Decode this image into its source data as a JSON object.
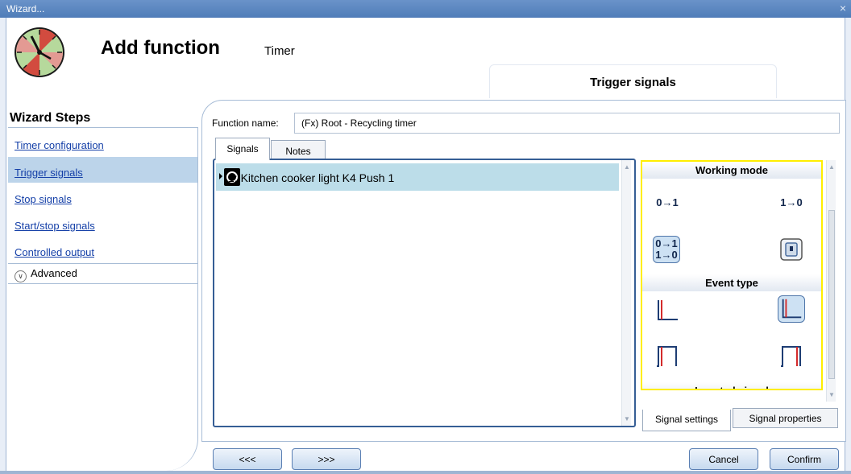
{
  "window": {
    "title": "Wizard...",
    "close_glyph": "×"
  },
  "header": {
    "title": "Add function",
    "subtitle": "Timer",
    "logo_icon": "timer-clock-icon",
    "step_tab": "Trigger signals"
  },
  "sidebar": {
    "title": "Wizard Steps",
    "items": [
      {
        "label": "Timer configuration",
        "selected": false
      },
      {
        "label": "Trigger signals",
        "selected": true
      },
      {
        "label": "Stop signals",
        "selected": false
      },
      {
        "label": "Start/stop signals",
        "selected": false
      },
      {
        "label": "Controlled output",
        "selected": false
      }
    ],
    "advanced": {
      "label": "Advanced",
      "icon": "chevron-down-circle-icon",
      "glyph": "∨"
    }
  },
  "form": {
    "function_name_label": "Function name:",
    "function_name_value": "(Fx) Root - Recycling timer"
  },
  "tabs": [
    "Signals",
    "Notes"
  ],
  "signals": [
    {
      "label": "1: Kitchen cooker light K4 Push 1",
      "icon": "push-button-icon"
    }
  ],
  "settings_panel": {
    "working_mode": {
      "title": "Working mode",
      "rising": "0→1",
      "falling": "1→0",
      "both_top": "0→1",
      "both_bottom": "1→0",
      "selected": "both"
    },
    "event_type": {
      "title": "Event type",
      "selected": "edge-long"
    },
    "inverted_signal": {
      "title": "Inverted signal"
    },
    "bottom_tabs": [
      "Signal settings",
      "Signal properties"
    ]
  },
  "buttons": {
    "prev": "<<<",
    "next": ">>>",
    "cancel": "Cancel",
    "confirm": "Confirm"
  },
  "colors": {
    "accent": "#4f7cb8",
    "highlight": "#ffee00",
    "selection": "#bcd4ea"
  }
}
